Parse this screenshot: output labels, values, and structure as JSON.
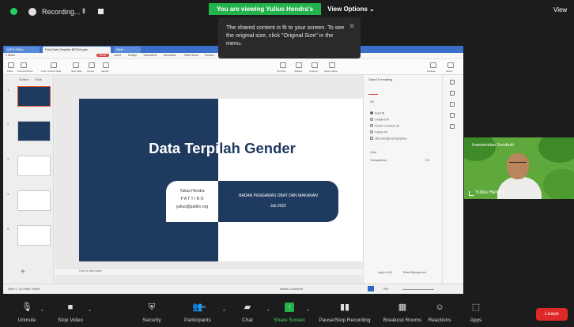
{
  "topbar": {
    "recording_label": "Recording...",
    "pause_label": "II",
    "viewing_banner": "You are viewing Yulius Hendra's screen",
    "view_options": "View Options ⌄",
    "view_right": "View"
  },
  "tooltip": {
    "text": "The shared content is fit to your screen. To see the original size, click \"Original Size\" in the menu.",
    "close": "✕"
  },
  "app": {
    "tabs": [
      "WPS Office",
      "Pola Data Terpilah BPOM.pptx",
      "Slide"
    ],
    "menu": [
      "≡ Menu",
      "Home",
      "Insert",
      "Design",
      "Transitions",
      "Animation",
      "Slide Show",
      "Review",
      "View",
      "Tools",
      "Click to find commands"
    ],
    "active_menu": "Home",
    "ribbon_labels": [
      "Paste",
      "Format Painter",
      "From Current Slide",
      "New Slide",
      "Layout",
      "Section",
      "Text Box",
      "Shapes",
      "Arrange",
      "Slide Outline",
      "Replace",
      "Select"
    ],
    "left_panel_tabs": [
      "Outline",
      "Slide"
    ],
    "thumb_numbers": [
      "1",
      "2",
      "3",
      "4",
      "5"
    ],
    "notes_placeholder": "Click to add notes",
    "status_left": "Slide 1 / 24    Office Theme",
    "status_right": "Notes   Comment",
    "zoom": "79%"
  },
  "slide": {
    "title_part1": "Data Terpi",
    "title_part2": "lah Gender",
    "name_line1": "Yulius Hendra",
    "name_line2": "P A T T I R O",
    "name_email": "yulius@pattiro.org",
    "org_name": "BADAN PENGAWAS OBAT DAN MAKANAN",
    "date": "Juli 2022"
  },
  "right_panel": {
    "title": "Object Formatting",
    "fill_label": "Fill",
    "options": [
      "Solid fill",
      "Gradient fill",
      "Picture or texture fill",
      "Pattern fill",
      "Hide background graphics"
    ],
    "color_label": "Color",
    "transparency_label": "Transparency",
    "transparency_value": "0%",
    "apply_all": "Apply to All",
    "reset": "Reset Background"
  },
  "video": {
    "top_label": "Inameinstan Sumbuiti",
    "name": "Yulius Hendra",
    "bg_color": "#5fa83b"
  },
  "toolbar": {
    "unmute": "Unmute",
    "stop_video": "Stop Video",
    "security": "Security",
    "participants": "Participants",
    "participants_count": "35",
    "chat": "Chat",
    "share_screen": "Share Screen",
    "pause_recording": "Pause/Stop Recording",
    "breakout_rooms": "Breakout Rooms",
    "reactions": "Reactions",
    "apps": "Apps",
    "leave": "Leave"
  }
}
